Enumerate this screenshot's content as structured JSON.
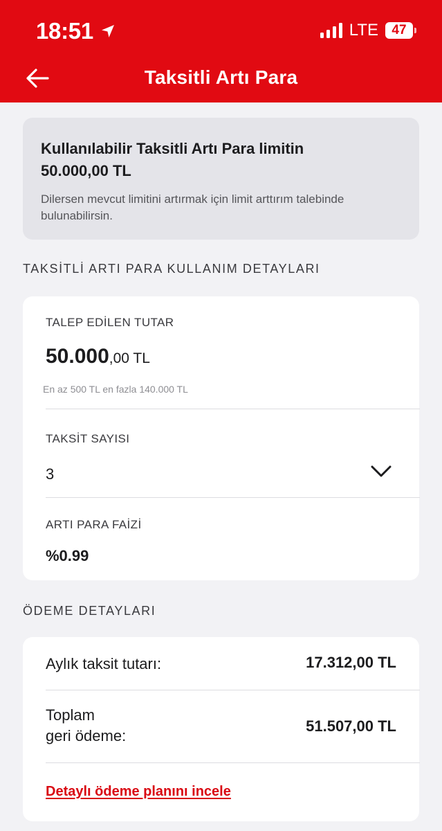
{
  "status_bar": {
    "time": "18:51",
    "network": "LTE",
    "battery": "47"
  },
  "header": {
    "title": "Taksitli Artı Para"
  },
  "limit_card": {
    "title": "Kullanılabilir Taksitli Artı Para limitin",
    "amount": "50.000,00  TL",
    "description": "Dilersen mevcut limitini artırmak için limit arttırım talebinde bulunabilirsin."
  },
  "usage_section": {
    "title": "TAKSİTLİ ARTI PARA KULLANIM DETAYLARI",
    "requested_amount_label": "TALEP EDİLEN TUTAR",
    "requested_amount_main": "50.000",
    "requested_amount_rest": ",00 TL",
    "amount_hint": "En az 500 TL en fazla 140.000 TL",
    "installment_count_label": "TAKSİT SAYISI",
    "installment_count_value": "3",
    "interest_label": "ARTI PARA FAİZİ",
    "interest_value": "%0.99"
  },
  "payment_section": {
    "title": "ÖDEME DETAYLARI",
    "monthly_label": "Aylık taksit tutarı:",
    "monthly_value": "17.312,00 TL",
    "total_label_line1": "Toplam",
    "total_label_line2": "geri ödeme:",
    "total_value": "51.507,00 TL",
    "plan_link": "Detaylı ödeme planını incele"
  },
  "colors": {
    "brand_red": "#e10a12",
    "link_red": "#d90812",
    "background": "#f2f2f5"
  },
  "icons": {
    "back": "arrow-left-icon",
    "location": "location-arrow-icon",
    "signal": "cellular-signal-icon",
    "battery": "battery-icon",
    "dropdown": "chevron-down-icon"
  }
}
